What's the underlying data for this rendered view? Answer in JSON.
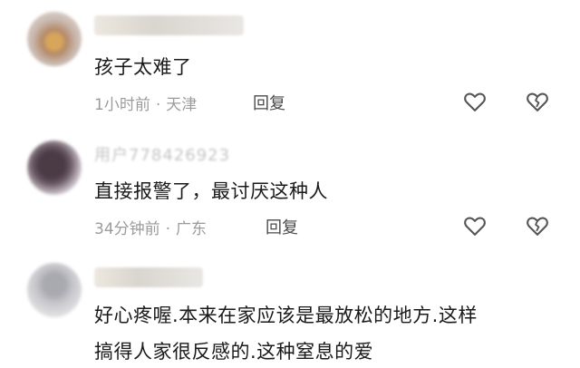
{
  "comments": [
    {
      "username": "",
      "text": "孩子太难了",
      "time": "1小时前",
      "location": "天津",
      "reply_label": "回复"
    },
    {
      "username": "用户778426923",
      "text": "直接报警了，最讨厌这种人",
      "time": "34分钟前",
      "location": "广东",
      "reply_label": "回复"
    },
    {
      "username": "",
      "text_line1": "好心疼喔.本来在家应该是最放松的地方.这样",
      "text_line2": "搞得人家很反感的.这种窒息的爱"
    }
  ],
  "separator": "·",
  "icons": [
    "heart-outline-icon",
    "broken-heart-icon"
  ],
  "colors": {
    "text": "#1a1a1a",
    "meta": "#9b9b9b",
    "icon": "#555555"
  }
}
